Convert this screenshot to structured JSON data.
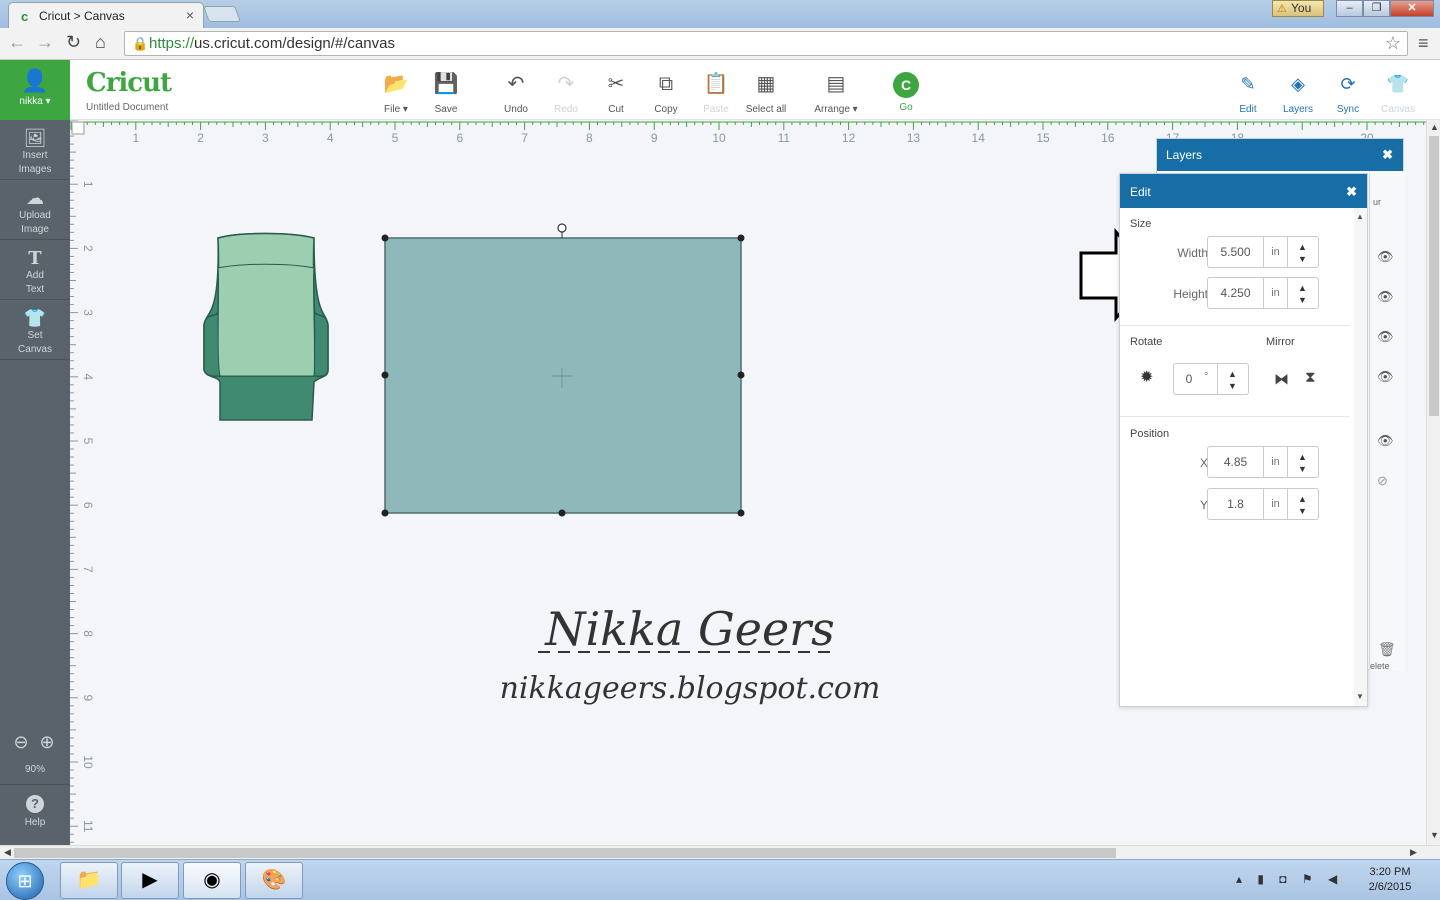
{
  "browser": {
    "tab_title": "Cricut > Canvas",
    "url_scheme": "https://",
    "url_rest": "us.cricut.com/design/#/canvas",
    "user_badge": "You",
    "window_buttons": [
      "–",
      "❐",
      "✕"
    ]
  },
  "header": {
    "user_name": "nikka ▾",
    "logo": "Cricut",
    "document_name": "Untitled Document",
    "tools": [
      {
        "label": "File ▾",
        "icon": "📂"
      },
      {
        "label": "Save",
        "icon": "💾"
      },
      {
        "label": "Undo",
        "icon": "↶"
      },
      {
        "label": "Redo",
        "icon": "↷"
      },
      {
        "label": "Cut",
        "icon": "✂"
      },
      {
        "label": "Copy",
        "icon": "⧉"
      },
      {
        "label": "Paste",
        "icon": "📋"
      },
      {
        "label": "Select all",
        "icon": "▦"
      },
      {
        "label": "Arrange ▾",
        "icon": "▤"
      },
      {
        "label": "Go",
        "icon": "C"
      }
    ],
    "right_tools": [
      {
        "label": "Edit",
        "icon": "✎"
      },
      {
        "label": "Layers",
        "icon": "◈"
      },
      {
        "label": "Sync",
        "icon": "⟳"
      },
      {
        "label": "Canvas",
        "icon": "👕"
      }
    ]
  },
  "sidebar": {
    "items": [
      {
        "label1": "Insert",
        "label2": "Images",
        "icon": "🖼"
      },
      {
        "label1": "Upload",
        "label2": "Image",
        "icon": "☁"
      },
      {
        "label1": "Add",
        "label2": "Text",
        "icon": "T"
      },
      {
        "label1": "Set",
        "label2": "Canvas",
        "icon": "👕"
      }
    ],
    "zoom": "90%",
    "help": "Help"
  },
  "ruler": {
    "h_labels": [
      "1",
      "2",
      "3",
      "4",
      "5",
      "6",
      "7",
      "8",
      "9",
      "10",
      "11",
      "12",
      "13",
      "14",
      "15",
      "16",
      "17",
      "18",
      "20"
    ],
    "v_labels": [
      "1",
      "2",
      "3",
      "4",
      "5",
      "6",
      "7",
      "8",
      "9",
      "10",
      "11"
    ]
  },
  "watermark": {
    "name": "Nikka Geers",
    "url": "nikkageers.blogspot.com"
  },
  "layers_panel": {
    "title": "Layers",
    "partial_col_text": "ur",
    "delete_text": "elete"
  },
  "edit_panel": {
    "title": "Edit",
    "size_title": "Size",
    "width_label": "Width",
    "width_value": "5.500",
    "width_unit": "in",
    "height_label": "Height",
    "height_value": "4.250",
    "height_unit": "in",
    "rotate_title": "Rotate",
    "rotate_value": "0",
    "rotate_unit": "°",
    "mirror_title": "Mirror",
    "position_title": "Position",
    "x_label": "X",
    "x_value": "4.85",
    "x_unit": "in",
    "y_label": "Y",
    "y_value": "1.8",
    "y_unit": "in"
  },
  "taskbar": {
    "time": "3:20 PM",
    "date": "2/6/2015"
  },
  "colors": {
    "cricut_green": "#3ea640",
    "panel_blue": "#176ea6",
    "shape_fill": "#8fb8ba",
    "card_dark": "#3f8a70",
    "card_light": "#9ccfb0"
  }
}
